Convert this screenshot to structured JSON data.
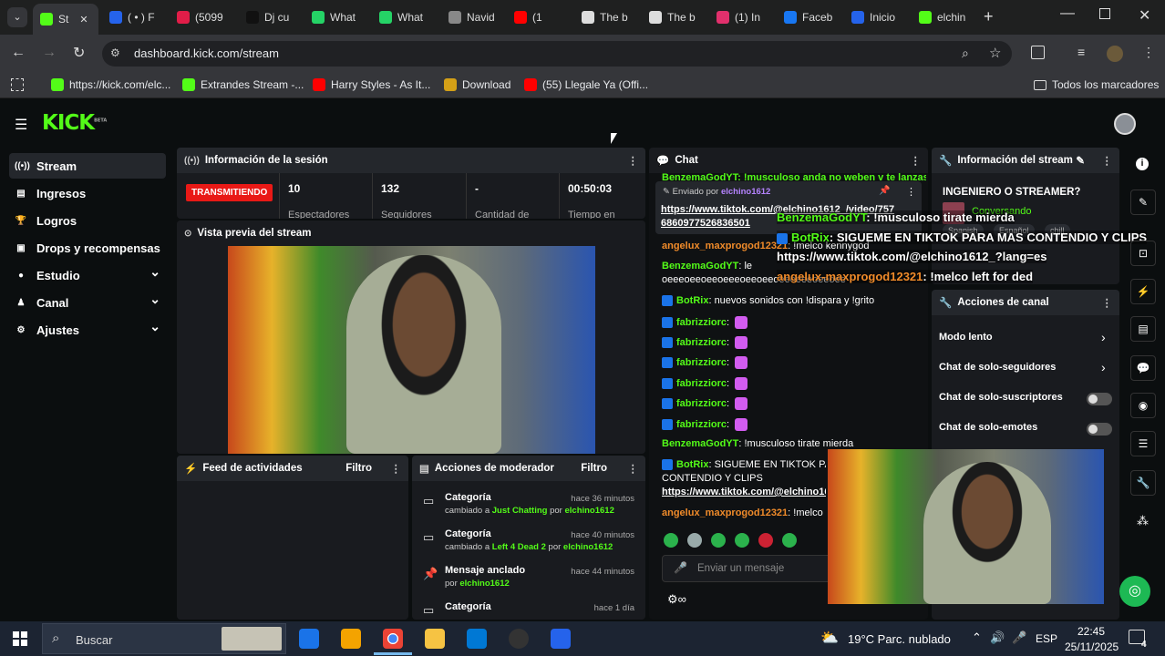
{
  "browser": {
    "tabs": [
      {
        "label": "St",
        "color": "#53fc18"
      },
      {
        "label": "( • ) F",
        "color": "#2563eb"
      },
      {
        "label": "(5099",
        "color": "#e11d48"
      },
      {
        "label": "Dj cu",
        "color": "#111111"
      },
      {
        "label": "What",
        "color": "#25d366"
      },
      {
        "label": "What",
        "color": "#25d366"
      },
      {
        "label": "Navid",
        "color": "#888888"
      },
      {
        "label": "(1",
        "color": "#ff0000"
      },
      {
        "label": "The b",
        "color": "#dddddd"
      },
      {
        "label": "The b",
        "color": "#dddddd"
      },
      {
        "label": "(1) In",
        "color": "#e1306c"
      },
      {
        "label": "Faceb",
        "color": "#1877f2"
      },
      {
        "label": "Inicio",
        "color": "#2563eb"
      },
      {
        "label": "elchin",
        "color": "#53fc18"
      }
    ],
    "url": "dashboard.kick.com/stream",
    "bookmarks": [
      {
        "label": "https://kick.com/elc...",
        "color": "#53fc18"
      },
      {
        "label": "Extrandes Stream -...",
        "color": "#53fc18"
      },
      {
        "label": "Harry Styles - As It...",
        "color": "#ff0000"
      },
      {
        "label": "Download",
        "color": "#d4a017"
      },
      {
        "label": "(55) Llegale Ya (Offi...",
        "color": "#ff0000"
      }
    ],
    "all_bookmarks": "Todos los marcadores"
  },
  "kick": {
    "logo": "KICK",
    "logo_sup": "BETA",
    "sidebar": [
      {
        "label": "Stream",
        "icon": "broadcast-icon",
        "glyph": "((•))",
        "chevron": ""
      },
      {
        "label": "Ingresos",
        "icon": "money-icon",
        "glyph": "▤",
        "chevron": ""
      },
      {
        "label": "Logros",
        "icon": "trophy-icon",
        "glyph": "🏆",
        "chevron": ""
      },
      {
        "label": "Drops y recompensas",
        "icon": "gift-icon",
        "glyph": "▣",
        "chevron": ""
      },
      {
        "label": "Estudio",
        "icon": "palette-icon",
        "glyph": "●",
        "chevron": "⌄"
      },
      {
        "label": "Canal",
        "icon": "group-icon",
        "glyph": "♟",
        "chevron": "⌄"
      },
      {
        "label": "Ajustes",
        "icon": "gear-icon",
        "glyph": "⚙",
        "chevron": "⌄"
      }
    ],
    "session": {
      "title": "Información de la sesión",
      "status": "TRANSMITIENDO",
      "stats": [
        {
          "value": "10",
          "label": "Espectadores"
        },
        {
          "value": "132",
          "label": "Seguidores"
        },
        {
          "value": "-",
          "label": "Cantidad de"
        },
        {
          "value": "00:50:03",
          "label": "Tiempo en"
        }
      ]
    },
    "preview": {
      "title": "Vista previa del stream"
    },
    "feed": {
      "title": "Feed de actividades",
      "filter": "Filtro"
    },
    "modactions": {
      "title": "Acciones de moderador",
      "filter": "Filtro",
      "items": [
        {
          "title": "Categoría",
          "time": "hace 36 minutos",
          "pre": "cambiado a ",
          "hl": "Just Chatting",
          "mid": " por ",
          "user": "elchino1612"
        },
        {
          "title": "Categoría",
          "time": "hace 40 minutos",
          "pre": "cambiado a ",
          "hl": "Left 4 Dead 2",
          "mid": " por ",
          "user": "elchino1612"
        },
        {
          "title": "Mensaje anclado",
          "time": "hace 44 minutos",
          "pre": "por ",
          "hl": "",
          "mid": "",
          "user": "elchino1612"
        },
        {
          "title": "Categoría",
          "time": "hace 1 día",
          "pre": "",
          "hl": "",
          "mid": "",
          "user": ""
        }
      ]
    },
    "chat": {
      "title": "Chat",
      "top_partial": "BenzemaGodYT: !musculoso anda no weben v te lanzas a",
      "pinned_by": "Enviado por",
      "pinned_user": "elchino1612",
      "pinned_link": "https://www.tiktok.com/@elchino1612_/video/757",
      "pinned_link2": "6860977526836501",
      "messages": [
        {
          "user": "angelux_maxprogod12321",
          "text": ": !melco kennygod"
        },
        {
          "user": "BenzemaGodYT",
          "text": ": le"
        },
        {
          "user": "",
          "text": "oeeeoeeoeeoeeeoeeoeeoeeoeeeoeeoee"
        },
        {
          "user": "BotRix",
          "text": ": nuevos sonidos con !dispara y !grito"
        },
        {
          "user": "fabrizziorc",
          "text": ":"
        },
        {
          "user": "fabrizziorc",
          "text": ":"
        },
        {
          "user": "fabrizziorc",
          "text": ":"
        },
        {
          "user": "fabrizziorc",
          "text": ":"
        },
        {
          "user": "fabrizziorc",
          "text": ":"
        },
        {
          "user": "fabrizziorc",
          "text": ":"
        },
        {
          "user": "BenzemaGodYT",
          "text": ": !musculoso tirate mierda"
        },
        {
          "user": "BotRix",
          "text": ": SIGUEME EN TIKTOK PA"
        },
        {
          "user": "",
          "text": "CONTENDIO Y CLIPS"
        },
        {
          "user": "",
          "text": "https://www.tiktok.com/@elchino1612_?"
        },
        {
          "user": "angelux_maxprogod12321",
          "text": ": !melco left"
        }
      ],
      "input_placeholder": "Enviar un mensaje"
    },
    "overlay": [
      {
        "user": "BenzemaGodYT",
        "text": ": !musculoso tirate mierda"
      },
      {
        "user": "BotRix",
        "text": ": SIGUEME EN TIKTOK PARA MAS CONTENDIO Y CLIPS"
      },
      {
        "user": "",
        "text": "https://www.tiktok.com/@elchino1612_?lang=es"
      },
      {
        "user": "angelux-maxprogod12321",
        "text": ": !melco left for ded"
      }
    ],
    "streaminfo": {
      "title": "Información del stream",
      "stream_title": "INGENIERO O STREAMER?",
      "category": "Conversando",
      "tags": [
        "Spanish",
        "Español",
        "chill"
      ]
    },
    "channel": {
      "title": "Acciones de canal",
      "rows": [
        {
          "label": "Modo lento"
        },
        {
          "label": "Chat de solo-seguidores"
        },
        {
          "label": "Chat de solo-suscriptores"
        },
        {
          "label": "Chat de solo-emotes"
        }
      ]
    }
  },
  "taskbar": {
    "search": "Buscar",
    "weather": "19°C  Parc. nublado",
    "lang": "ESP",
    "time": "22:45",
    "date": "25/11/2025",
    "notif": "4"
  }
}
